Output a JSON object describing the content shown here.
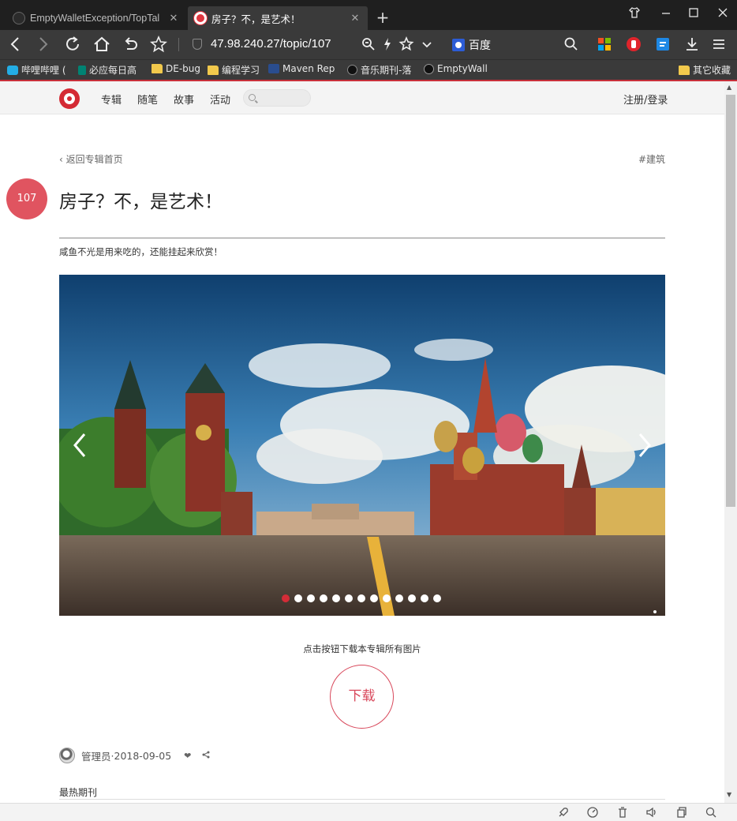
{
  "browser": {
    "tabs": [
      {
        "title": "EmptyWalletException/TopTal",
        "close": "✕"
      },
      {
        "title": "房子？不，是艺术！",
        "close": "✕"
      }
    ],
    "new_tab": "+",
    "url": "47.98.240.27/topic/107",
    "search_engine": "百度",
    "bookmarks": [
      {
        "label": "哔哩哔哩 (",
        "icon": "bilibili-icon"
      },
      {
        "label": "必应每日高",
        "icon": "bing-icon"
      },
      {
        "label": "DE-bug",
        "icon": "folder-icon"
      },
      {
        "label": "编程学习",
        "icon": "folder-icon"
      },
      {
        "label": "Maven Rep",
        "icon": "maven-icon"
      },
      {
        "label": "音乐期刊-落",
        "icon": "music-icon"
      },
      {
        "label": "EmptyWall",
        "icon": "github-icon"
      }
    ],
    "other_bookmarks": "其它收藏",
    "accent_color": "#c8303a"
  },
  "site": {
    "nav": [
      "专辑",
      "随笔",
      "故事",
      "活动"
    ],
    "login": "注册/登录"
  },
  "article": {
    "back": "返回专辑首页",
    "tag": "#建筑",
    "number": "107",
    "title": "房子？不，是艺术！",
    "subtitle": "咸鱼不光是用来吃的，还能挂起来欣赏！",
    "carousel": {
      "total_slides": 13,
      "active_index": 0
    },
    "download_hint": "点击按钮下载本专辑所有图片",
    "download_label": "下载",
    "author": "管理员",
    "date_sep": "·",
    "date": "2018-09-05",
    "hot_label": "最热期刊"
  },
  "colors": {
    "primary": "#d32c37",
    "badge": "#e05460"
  }
}
